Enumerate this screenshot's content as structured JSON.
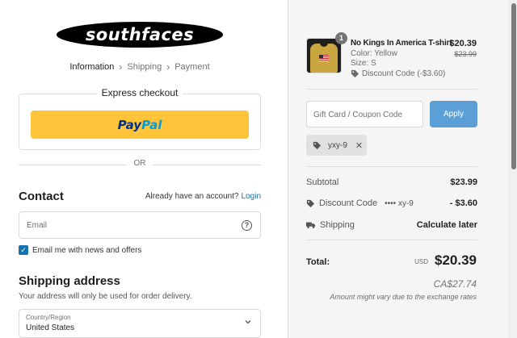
{
  "brand": {
    "logo_text": "southfaces"
  },
  "breadcrumb": {
    "items": [
      "Information",
      "Shipping",
      "Payment"
    ],
    "current": "Information",
    "separator": "›"
  },
  "express": {
    "label": "Express checkout",
    "paypal_part1": "Pay",
    "paypal_part2": "Pal",
    "paypal_color": "#ffc439"
  },
  "divider_text": "OR",
  "contact": {
    "heading": "Contact",
    "account_prompt": "Already have an account?",
    "login_link": "Login",
    "email_placeholder": "Email",
    "help_icon": "?",
    "newsletter_label": "Email me with news and offers",
    "newsletter_checked": true
  },
  "shipping": {
    "heading": "Shipping address",
    "subtext": "Your address will only be used for order delivery.",
    "country_label": "Country/Region",
    "country_value": "United States"
  },
  "cart": {
    "item": {
      "name": "No Kings In America T-shirt",
      "color": "Color: Yellow",
      "size": "Size: S",
      "discount": "Discount Code (-$3.60)",
      "price": "$20.39",
      "original_price": "$23.99",
      "quantity": "1"
    },
    "coupon_placeholder": "Gift Card / Coupon Code",
    "apply_label": "Apply",
    "applied_code": "yxy-9",
    "subtotal_label": "Subtotal",
    "subtotal_value": "$23.99",
    "discount_label": "Discount Code",
    "discount_code_masked": "•••• xy-9",
    "discount_value": "- $3.60",
    "shipping_label": "Shipping",
    "shipping_value": "Calculate later",
    "total_label": "Total:",
    "total_currency": "USD",
    "total_value": "$20.39",
    "converted_total": "CA$27.74",
    "exchange_note": "Amount might vary due to the exchange rates"
  },
  "colors": {
    "accent": "#1773b0",
    "apply_button": "#5b9fd6",
    "summary_bg": "#f5f5f5"
  }
}
